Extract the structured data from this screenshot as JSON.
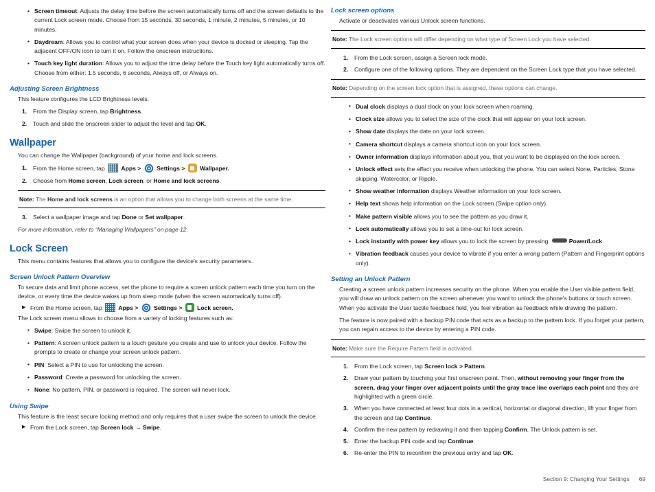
{
  "page": {
    "footer_section": "Section 9:  Changing Your Settings",
    "footer_page": "69",
    "heading_color": "#1a66b3",
    "note_rule_color": "#000000"
  },
  "icons": {
    "apps": "apps-grid-icon",
    "settings": "settings-gear-icon",
    "wallpaper": "wallpaper-image-icon",
    "lockscreen": "lock-screen-icon",
    "powerkey": "power-key-icon"
  },
  "left_column": {
    "top_bullets": [
      {
        "term": "Screen timeout",
        "text": ": Adjusts the delay time before the screen automatically turns off and the screen defaults to the current Lock screen mode. Choose from 15 seconds, 30 seconds, 1 minute, 2 minutes, 5 minutes, or 10 minutes."
      },
      {
        "term": "Daydream",
        "text": ": Allows you to control what your screen does when your device is docked or sleeping. Tap the adjacent OFF/ON icon to turn it on. Follow the onscreen instructions."
      },
      {
        "term": "Touch key light duration",
        "text": ": Allows you to adjust the time delay before the Touch key light automatically turns off. Choose from either: 1.5 seconds, 6 seconds, Always off, or Always on."
      }
    ],
    "adjusting_brightness": {
      "title": "Adjusting Screen Brightness",
      "intro": "This feature configures the LCD Brightness levels.",
      "steps": [
        {
          "pre": "From the Display screen, tap ",
          "bold": "Brightness",
          "post": "."
        },
        {
          "pre": "Touch and slide the onscreen slider to adjust the level and tap ",
          "bold": "OK",
          "post": "."
        }
      ]
    },
    "wallpaper": {
      "title": "Wallpaper",
      "intro": "You can change the Wallpaper (background) of your home and lock screens.",
      "step1_pre": "From the Home screen, tap",
      "step1_apps": "Apps >",
      "step1_settings": "Settings >",
      "step1_wallpaper": "Wallpaper.",
      "step2_pre": "Choose from ",
      "step2_b1": "Home screen",
      "step2_mid1": ", ",
      "step2_b2": "Lock screen",
      "step2_mid2": ", or ",
      "step2_b3": "Home and lock screens",
      "step2_post": ".",
      "note_label": "Note:",
      "note_pre": " The ",
      "note_bold": "Home and lock screens",
      "note_post": " is an option that allows you to change both screens at the same time.",
      "step3_pre": "Select a wallpaper image and tap ",
      "step3_b1": "Done",
      "step3_mid": " or ",
      "step3_b2": "Set wallpaper",
      "step3_post": ".",
      "xref": "For more information, refer to “Managing Wallpapers” on page 12."
    },
    "lock_screen": {
      "title": "Lock Screen",
      "intro": "This menu contains features that allows you to configure the device's security parameters."
    },
    "screen_unlock_overview": {
      "title": "Screen Unlock Pattern Overview",
      "intro": "To secure data and limit phone access, set the phone to require a screen unlock pattern each time you turn on the device, or every time the device wakes up from sleep mode (when the screen automatically turns off).",
      "arrow_pre": "From the Home screen, tap",
      "arrow_apps": "Apps >",
      "arrow_settings": "Settings >",
      "arrow_lockscreen": "Lock screen.",
      "after": "The Lock screen menu allows to choose from a variety of locking features such as:",
      "bullets": [
        {
          "term": "Swipe",
          "text": ": Swipe the screen to unlock it."
        },
        {
          "term": "Pattern",
          "text": ": A screen unlock pattern is a touch gesture you create and use to unlock your device. Follow the prompts to create or change your screen unlock pattern."
        },
        {
          "term": "PIN",
          "text": ": Select a PIN to use for unlocking the screen."
        },
        {
          "term": "Password",
          "text": ": Create a password for unlocking the screen."
        },
        {
          "term": "None",
          "text": ": No pattern, PIN, or password is required. The screen will never lock."
        }
      ]
    },
    "using_swipe": {
      "title": "Using Swipe",
      "intro": "This feature is the least secure locking method and only requires that a user swipe the screen to unlock the device.",
      "arrow_pre": "From the Lock screen, tap ",
      "arrow_b1": "Screen lock",
      "arrow_mid": " → ",
      "arrow_b2": "Swipe",
      "arrow_post": "."
    }
  },
  "right_column": {
    "lock_screen_options": {
      "title": "Lock screen options",
      "intro": "Activate or deactivates various Unlock screen functions.",
      "note1_label": "Note:",
      "note1_text": " The Lock screen options will differ depending on what type of Screen Lock you have selected.",
      "steps": [
        {
          "pre": "From the Lock screen, assign a Screen lock mode.",
          "bold": "",
          "post": ""
        },
        {
          "pre": "Configure one of the following options. They are dependent on the Screen Lock type that you have selected.",
          "bold": "",
          "post": ""
        }
      ],
      "note2_label": "Note:",
      "note2_text": " Depending on the screen lock option that is assigned, these options can change.",
      "bullets": [
        {
          "term": "Dual clock",
          "text": " displays a dual clock on your lock screen when roaming."
        },
        {
          "term": "Clock size",
          "text": " allows you to select the size of the clock that will appear on your lock screen."
        },
        {
          "term": "Show date",
          "text": " displays the date on your lock screen."
        },
        {
          "term": "Camera shortcut",
          "text": " displays a camera shortcut icon on your lock screen."
        },
        {
          "term": "Owner information",
          "text": " displays information about you, that you want to be displayed on the lock screen."
        },
        {
          "term": "Unlock effect",
          "text": " sets the effect you receive when unlocking the phone. You can select None, Particles, Stone skipping, Watercolor, or Ripple."
        },
        {
          "term": "Show weather information",
          "text": " displays Weather information on your lock screen."
        },
        {
          "term": "Help text",
          "text": " shows help information on the Lock screen (Swipe option only)."
        },
        {
          "term": "Make pattern visible",
          "text": " allows you to see the pattern as you draw it."
        },
        {
          "term": "Lock automatically",
          "text": " allows you to set a time-out for lock screen."
        }
      ],
      "power_bullet": {
        "term": "Lock instantly with power key",
        "text": " allows you to lock the screen by pressing ",
        "bold_tail": "Power/Lock",
        "post": "."
      },
      "last_bullet": {
        "term": "Vibration feedback",
        "text": " causes your device to vibrate if you enter a wrong pattern (Pattern and Fingerprint options only)."
      }
    },
    "setting_unlock_pattern": {
      "title": "Setting an Unlock Pattern",
      "para1": "Creating a screen unlock pattern increases security on the phone. When you enable the User visible pattern field, you will draw an unlock pattern on the screen whenever you want to unlock the phone’s buttons or touch screen. When you activate the User tactile feedback field, you feel vibration as feedback while drawing the pattern.",
      "para2": "The feature is now paired with a backup PIN code that acts as a backup to the pattern lock. If you forget your pattern, you can regain access to the device by entering a PIN code.",
      "note_label": "Note:",
      "note_text": " Make sure the Require Pattern field is activated.",
      "steps": [
        {
          "pre": "From the Lock screen, tap ",
          "bold": "Screen lock > Pattern",
          "post": "."
        },
        {
          "pre": "Draw your pattern by touching your first onscreen point. Then, ",
          "bold": "without removing your finger from the screen, drag your finger over adjacent points until the gray trace line overlaps each point",
          "post": " and they are highlighted with a green circle."
        },
        {
          "pre": "When you have connected at least four dots in a vertical, horizontal or diagonal direction, lift your finger from the screen and tap ",
          "bold": "Continue",
          "post": "."
        },
        {
          "pre": "Confirm the new pattern by redrawing it and then tapping ",
          "bold": "Confirm",
          "post": ". The Unlock pattern is set."
        },
        {
          "pre": "Enter the backup PIN code and tap ",
          "bold": "Continue",
          "post": "."
        },
        {
          "pre": "Re-enter the PIN to reconfirm the previous entry and tap ",
          "bold": "OK",
          "post": "."
        }
      ]
    }
  }
}
